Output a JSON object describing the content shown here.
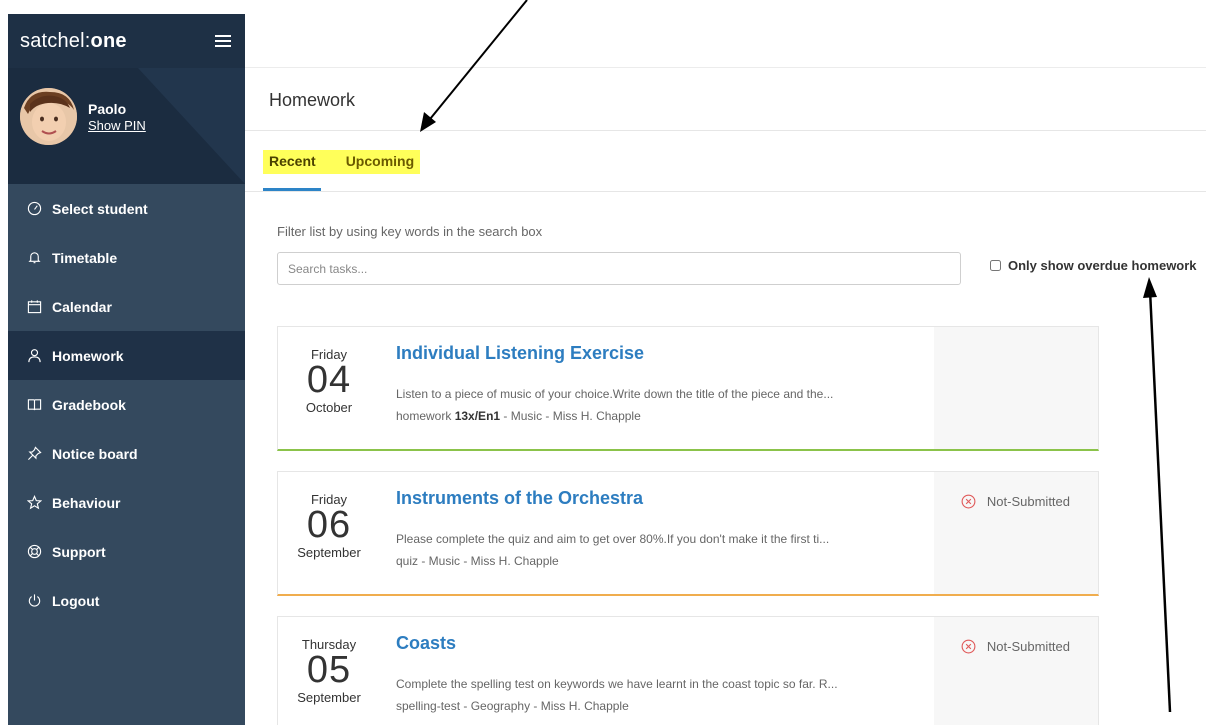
{
  "sidebar": {
    "brand": {
      "prefix": "satchel:",
      "suffix": "one"
    },
    "profile": {
      "name": "Paolo",
      "pin_link": "Show PIN"
    },
    "items": [
      {
        "label": "Select student",
        "icon": "dashboard-icon"
      },
      {
        "label": "Timetable",
        "icon": "bell-icon"
      },
      {
        "label": "Calendar",
        "icon": "calendar-icon"
      },
      {
        "label": "Homework",
        "icon": "user-icon"
      },
      {
        "label": "Gradebook",
        "icon": "book-icon"
      },
      {
        "label": "Notice board",
        "icon": "pin-icon"
      },
      {
        "label": "Behaviour",
        "icon": "star-icon"
      },
      {
        "label": "Support",
        "icon": "lifebuoy-icon"
      },
      {
        "label": "Logout",
        "icon": "power-icon"
      }
    ],
    "active_item": "Homework"
  },
  "main": {
    "title": "Homework",
    "tabs": [
      {
        "label": "Recent"
      },
      {
        "label": "Upcoming"
      }
    ],
    "active_tab": "Recent",
    "filter_hint": "Filter list by using key words in the search box",
    "search_placeholder": "Search tasks...",
    "overdue_label": "Only show overdue homework",
    "tasks": [
      {
        "dow": "Friday",
        "day": "04",
        "month": "October",
        "title": "Individual Listening Exercise",
        "description": "Listen to a piece of music of your choice.Write down the title of the piece and the...",
        "meta_type": "homework",
        "meta_class": "13x/En1",
        "meta_rest": " - Music - Miss H. Chapple",
        "status": ""
      },
      {
        "dow": "Friday",
        "day": "06",
        "month": "September",
        "title": "Instruments of the Orchestra",
        "description": "Please complete the quiz and aim to get over 80%.If you don't make it the first ti...",
        "meta_type": "quiz - Music - Miss H. Chapple",
        "status": "Not-Submitted"
      },
      {
        "dow": "Thursday",
        "day": "05",
        "month": "September",
        "title": "Coasts",
        "description": "Complete the spelling test on keywords we have learnt in the coast topic so far. R...",
        "meta_type": "spelling-test - Geography - Miss H. Chapple",
        "status": "Not-Submitted"
      }
    ]
  },
  "colors": {
    "sidebar": "#34495e",
    "sidebar_dark": "#1e3045",
    "accent_link": "#2d7dc0",
    "highlight": "#ffff5a",
    "card_green": "#8bc34a",
    "card_orange": "#f0ad4e",
    "not_submitted": "#e05a5a"
  }
}
